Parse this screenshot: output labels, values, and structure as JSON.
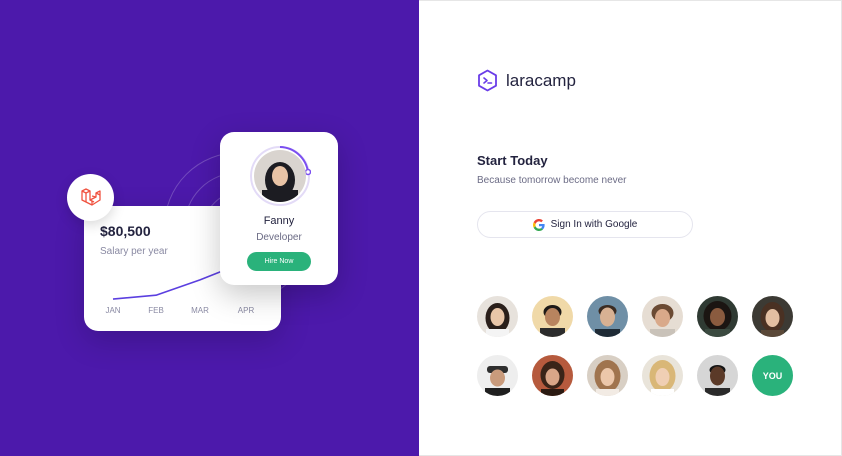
{
  "brand": {
    "name": "laracamp",
    "accent": "#6a3ce8"
  },
  "hero": {
    "background": "#4c19ab",
    "salary_card": {
      "amount": "$80,500",
      "label": "Salary per year",
      "months": [
        "JAN",
        "FEB",
        "MAR",
        "APR"
      ],
      "trend": [
        2,
        10,
        42,
        80
      ]
    },
    "profile_card": {
      "name": "Fanny",
      "role": "Developer",
      "hire_label": "Hire Now"
    }
  },
  "auth": {
    "title": "Start Today",
    "subtitle": "Because tomorrow become never",
    "google_label": "Sign In with Google"
  },
  "community": {
    "you_label": "YOU",
    "you_color": "#2ab27b"
  },
  "colors": {
    "green": "#2ab27b",
    "laravel_red": "#f05340"
  }
}
